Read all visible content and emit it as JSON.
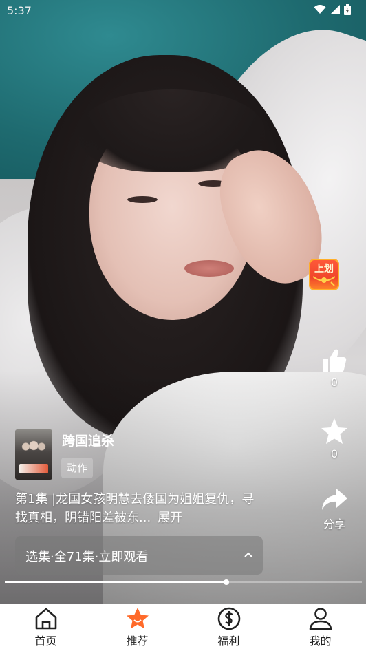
{
  "status_bar": {
    "time": "5:37"
  },
  "red_envelope": {
    "label": "上划"
  },
  "actions": {
    "like_count": "0",
    "favorite_count": "0",
    "share_label": "分享"
  },
  "drama": {
    "title": "跨国追杀",
    "genre": "动作",
    "description": "第1集 |龙国女孩明慧去倭国为姐姐复仇，寻找真相，阴错阳差被东...",
    "expand_label": "展开",
    "episode_selector": "选集·全71集·立即观看"
  },
  "progress": {
    "played_fraction": 0.62
  },
  "bottom_nav": {
    "items": [
      {
        "label": "首页",
        "icon": "home-icon",
        "active": false
      },
      {
        "label": "推荐",
        "icon": "star-icon",
        "active": true
      },
      {
        "label": "福利",
        "icon": "dollar-icon",
        "active": false
      },
      {
        "label": "我的",
        "icon": "person-icon",
        "active": false
      }
    ]
  },
  "colors": {
    "accent": "#ff6a2a",
    "nav_background": "#ffffff"
  }
}
